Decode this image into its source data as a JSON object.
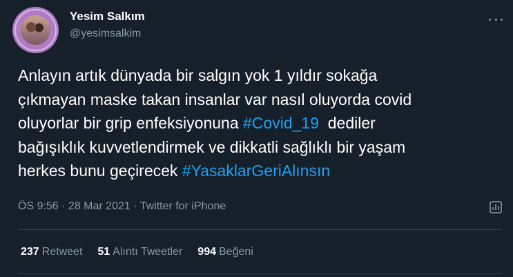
{
  "author": {
    "name": "Yesim Salkım",
    "handle": "@yesimsalkim"
  },
  "tweet": {
    "line1": "Anlayın artık dünyada bir salgın yok 1 yıldır sokağa",
    "line2": "çıkmayan maske takan insanlar var nasıl oluyorda covid",
    "line3_pre": "oluyorlar bir grip enfeksiyonuna ",
    "hashtag1": "#Covid_19",
    "line3_post": "  dediler",
    "line4": "bağışıklık kuvvetlendirmek ve dikkatli sağlıklı bir yaşam",
    "line5_pre": "herkes bunu geçirecek ",
    "hashtag2": "#YasaklarGeriAlınsın"
  },
  "meta": {
    "time": "ÖS 9:56",
    "separator": " · ",
    "date": "28 Mar 2021",
    "source": "Twitter for iPhone"
  },
  "stats": {
    "retweets_count": "237",
    "retweets_label": "Retweet",
    "quotes_count": "51",
    "quotes_label": "Alıntı Tweetler",
    "likes_count": "994",
    "likes_label": "Beğeni"
  },
  "icons": {
    "more": "more-horizontal-icon",
    "analytics": "analytics-icon"
  },
  "colors": {
    "background": "#15202b",
    "hashtag": "#1da1f2",
    "secondary_text": "#8899a6"
  }
}
